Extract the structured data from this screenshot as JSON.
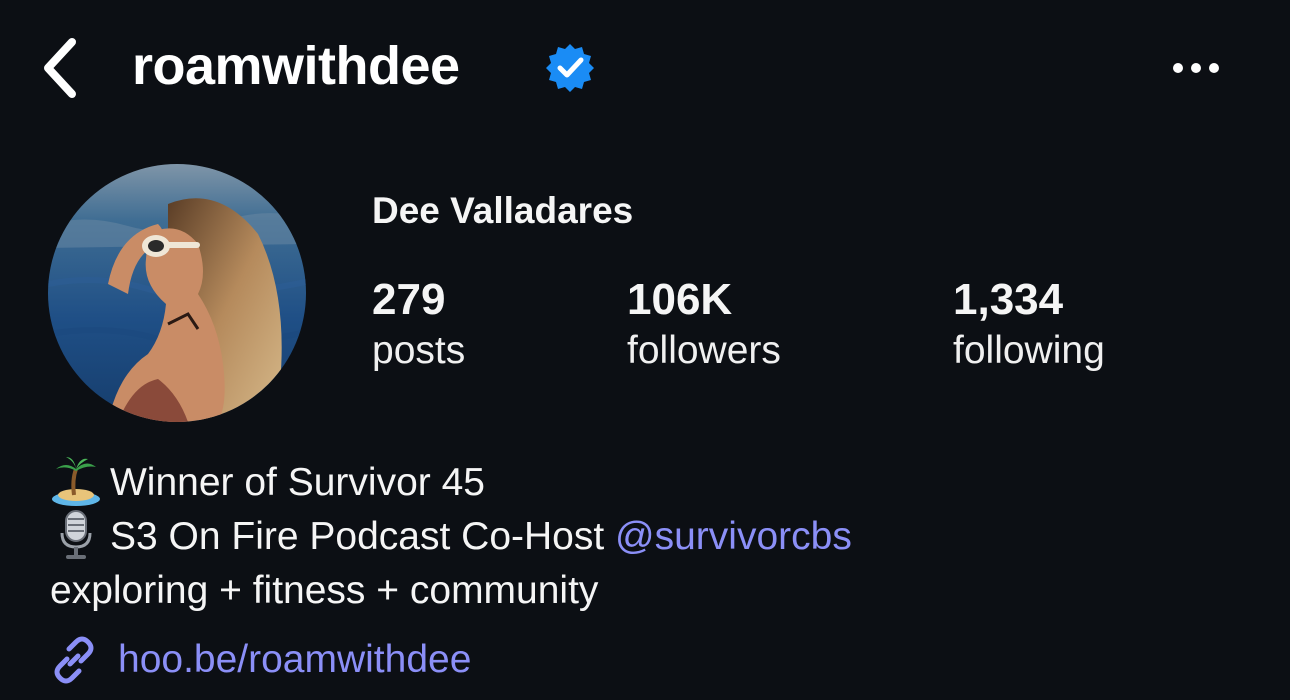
{
  "header": {
    "username": "roamwithdee",
    "verified_color": "#1a8cf5",
    "back_icon": "chevron-left-icon",
    "more_icon": "more-horizontal-icon"
  },
  "profile": {
    "display_name": "Dee Valladares",
    "stats": [
      {
        "value": "279",
        "label": "posts"
      },
      {
        "value": "106K",
        "label": "followers"
      },
      {
        "value": "1,334",
        "label": "following"
      }
    ]
  },
  "bio": {
    "line1_emoji": "desert-island-icon",
    "line1_text": "Winner of Survivor 45",
    "line2_emoji": "studio-microphone-icon",
    "line2_text": "S3 On Fire Podcast Co-Host ",
    "line2_mention": "@survivorcbs",
    "line3_text": "exploring + fitness + community"
  },
  "link": {
    "icon": "link-icon",
    "text": "hoo.be/roamwithdee"
  },
  "colors": {
    "background": "#0c0f14",
    "accent_link": "#8b8ff7",
    "text": "#f5f5f5"
  }
}
